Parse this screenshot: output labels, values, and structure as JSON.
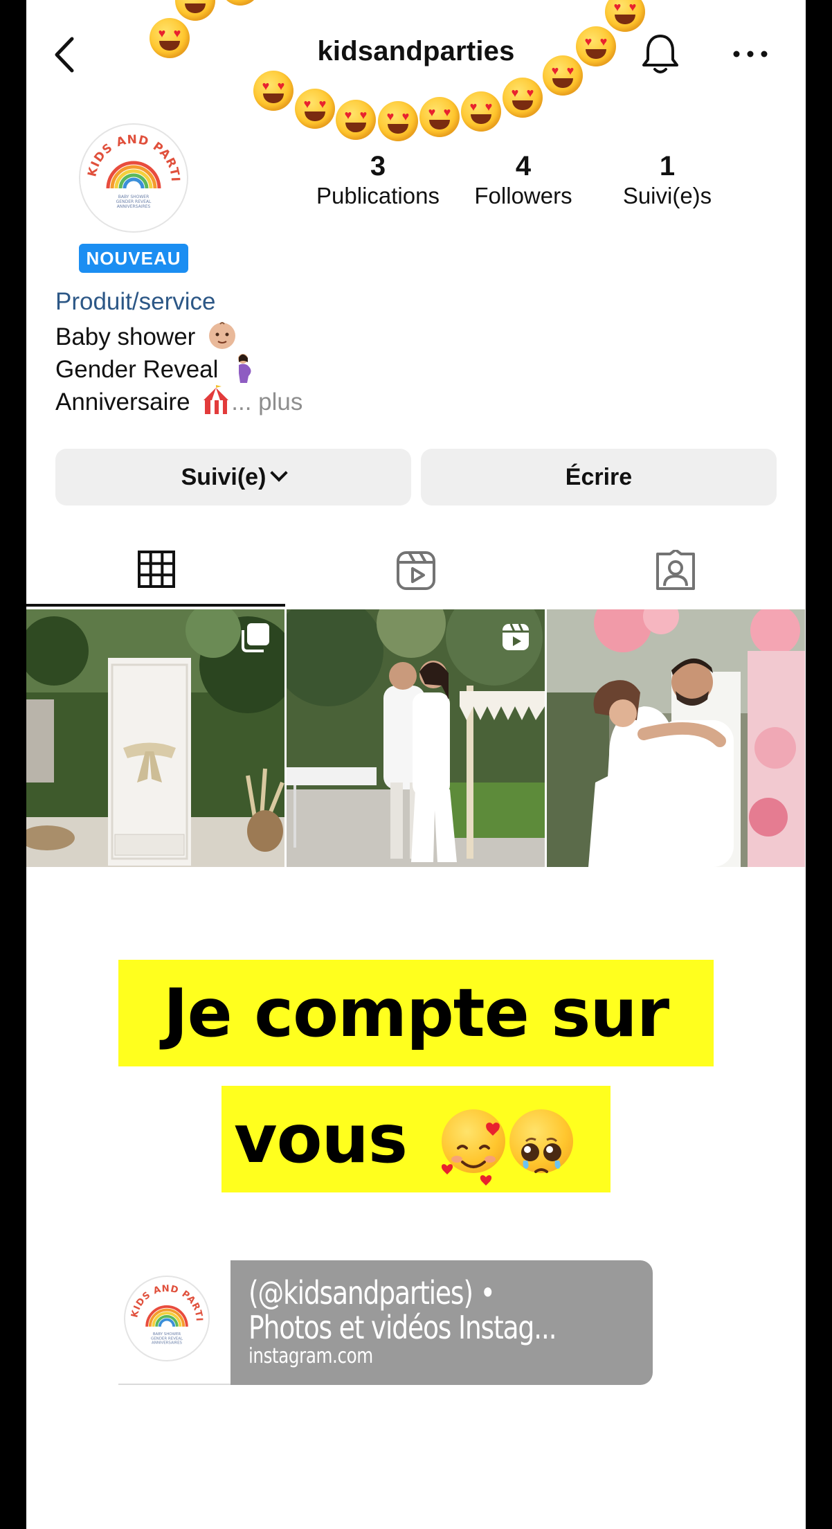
{
  "header": {
    "username": "kidsandparties",
    "icons": [
      "back-arrow-icon",
      "bell-icon",
      "more-options-icon"
    ]
  },
  "profile": {
    "badge": "NOUVEAU",
    "stats": [
      {
        "value": "3",
        "label": "Publications"
      },
      {
        "value": "4",
        "label": "Followers"
      },
      {
        "value": "1",
        "label": "Suivi(e)s"
      }
    ],
    "category": "Produit/service",
    "bio": [
      {
        "text": "Baby shower",
        "emoji": "baby-face-emoji"
      },
      {
        "text": "Gender Reveal",
        "emoji": "pregnant-woman-emoji"
      },
      {
        "text": "Anniversaire",
        "emoji": "circus-tent-emoji",
        "more": "... plus"
      }
    ],
    "logo_text": "KIDS AND PARTIES",
    "logo_subtext": [
      "BABY SHOWER",
      "GENDER REVEAL",
      "ANNIVERSAIRES"
    ]
  },
  "actions": {
    "following_label": "Suivi(e)",
    "message_label": "Écrire"
  },
  "tabs": [
    "grid-icon",
    "reels-icon",
    "tagged-icon"
  ],
  "posts": [
    {
      "name": "post-white-door",
      "badge": "multiple-photos-icon"
    },
    {
      "name": "post-couple-garden",
      "badge": "reel-icon"
    },
    {
      "name": "post-couple-hug",
      "badge": ""
    }
  ],
  "caption": {
    "line1": "Je compte sur",
    "line2": "vous",
    "emojis": [
      "smiling-face-with-hearts-emoji",
      "pleading-face-emoji"
    ]
  },
  "link_preview": {
    "title": "(@kidsandparties) • Photos et vidéos Instag...",
    "domain": "instagram.com"
  },
  "colors": {
    "category": "#2c5786",
    "badge": "#1b8ef2",
    "caption_highlight": "#ffff1e",
    "button_bg": "#efefef"
  }
}
